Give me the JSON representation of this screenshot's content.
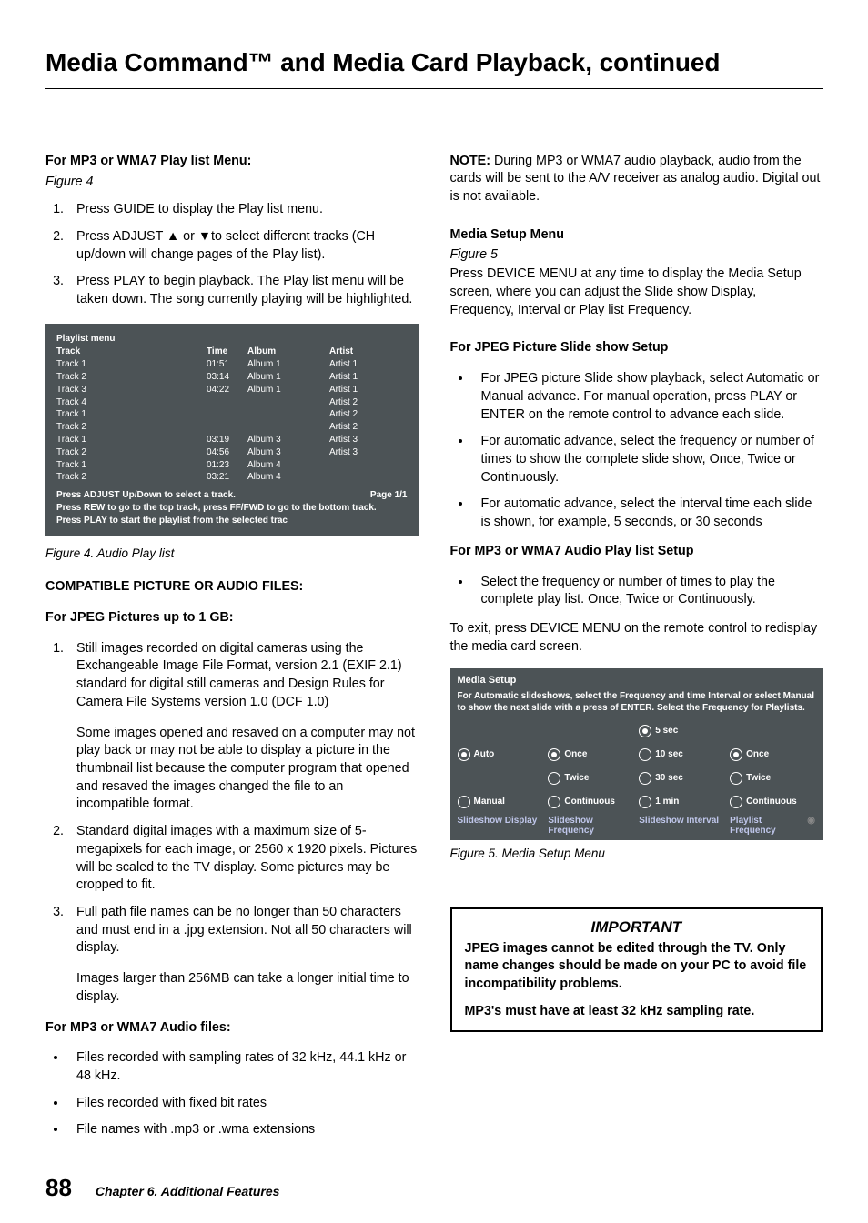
{
  "page_title": "Media Command™ and Media Card Playback, continued",
  "left": {
    "h1": "For MP3 or WMA7 Play list Menu:",
    "fig4_label": "Figure 4",
    "ol1": [
      "Press GUIDE to display the Play list menu.",
      "Press ADJUST ▲ or ▼to select different tracks (CH up/down will change pages of the Play list).",
      "Press PLAY to begin playback.  The Play list menu will be taken down. The song currently playing will be highlighted."
    ],
    "playlist": {
      "title": "Playlist menu",
      "headers": [
        "Track",
        "Time",
        "Album",
        "Artist"
      ],
      "rows": [
        [
          "Track 1",
          "01:51",
          "Album 1",
          "Artist 1"
        ],
        [
          "Track 2",
          "03:14",
          "Album 1",
          "Artist 1"
        ],
        [
          "Track 3",
          "04:22",
          "Album 1",
          "Artist 1"
        ],
        [
          "Track 4",
          "",
          "",
          "Artist 2"
        ],
        [
          "Track 1",
          "",
          "",
          "Artist 2"
        ],
        [
          "Track 2",
          "",
          "",
          "Artist 2"
        ],
        [
          "Track 1",
          "03:19",
          "Album 3",
          "Artist 3"
        ],
        [
          "Track 2",
          "04:56",
          "Album 3",
          "Artist 3"
        ],
        [
          "Track 1",
          "01:23",
          "Album 4",
          ""
        ],
        [
          "Track 2",
          "03:21",
          "Album 4",
          ""
        ]
      ],
      "foot1a": "Press ADJUST Up/Down to select a track.",
      "foot1b": "Page 1/1",
      "foot2": "Press REW to go to the top track, press FF/FWD to go to the bottom track.",
      "foot3": "Press PLAY to start the playlist from the selected trac"
    },
    "caption4": "Figure 4.  Audio Play list",
    "h2": "COMPATIBLE PICTURE OR AUDIO FILES:",
    "h3": "For JPEG Pictures up to 1 GB:",
    "ol2": [
      "Still images recorded on digital cameras using the Exchangeable Image File Format, version 2.1 (EXIF 2.1) standard for digital still cameras and Design Rules for Camera File Systems version 1.0 (DCF 1.0)",
      "Standard digital images with a maximum size of 5-megapixels for each image, or 2560 x 1920 pixels.  Pictures will be scaled to the TV display.  Some pictures may be cropped to fit.",
      "Full path file names can be no longer than 50 characters and must end in a .jpg extension.  Not all 50 characters will display."
    ],
    "ol2_sub1": "Some images opened and resaved on a computer may not play back or may not be able to display a picture in the thumbnail list because the computer program that opened and resaved the images changed the file to an incompatible format.",
    "ol2_sub3": "Images larger than 256MB can take a longer initial time to display.",
    "h4": "For MP3 or WMA7 Audio files:",
    "ul1": [
      "Files recorded with sampling rates of 32 kHz, 44.1 kHz or 48 kHz.",
      "Files recorded with fixed bit rates",
      "File names with .mp3 or .wma extensions"
    ]
  },
  "right": {
    "note_label": "NOTE:",
    "note_text": "  During MP3 or WMA7 audio playback, audio from the cards will be sent to the A/V receiver as analog audio.  Digital out is not available.",
    "h1": "Media Setup Menu",
    "fig5_label": "Figure 5",
    "p1": "Press DEVICE MENU at any time to display the Media Setup screen, where you can adjust the Slide show Display, Frequency, Interval or Play list Frequency.",
    "h2": "For JPEG Picture Slide show Setup",
    "ul1": [
      "For JPEG picture Slide show playback, select Automatic or Manual advance.  For manual operation, press PLAY or ENTER on the remote control to advance each slide.",
      "For automatic advance, select the frequency or number of times to show the complete slide show, Once, Twice or Continuously.",
      "For automatic advance, select the interval time each slide is shown, for example, 5 seconds, or 30 seconds"
    ],
    "h3": "For MP3 or WMA7 Audio Play list Setup",
    "ul2": [
      "Select the frequency or number of times to play the complete play list.  Once, Twice or Continuously."
    ],
    "p2": "To exit, press DEVICE MENU on the remote control to redisplay the media card screen.",
    "media_setup": {
      "title": "Media Setup",
      "desc": "For Automatic slideshows, select the Frequency and time Interval or select Manual to show the next slide with a press of ENTER. Select the Frequency for Playlists.",
      "col1": {
        "opts": [
          "Auto",
          "Manual"
        ],
        "sel": 0,
        "label": "Slideshow Display"
      },
      "col2": {
        "opts": [
          "Once",
          "Twice",
          "Continuous"
        ],
        "sel": 0,
        "label": "Slideshow Frequency"
      },
      "col3": {
        "opts": [
          "5 sec",
          "10 sec",
          "30 sec",
          "1 min"
        ],
        "sel": 0,
        "label": "Slideshow Interval"
      },
      "col4": {
        "opts": [
          "Once",
          "Twice",
          "Continuous"
        ],
        "sel": 0,
        "label": "Playlist Frequency"
      }
    },
    "caption5": "Figure 5.  Media Setup Menu",
    "important": {
      "title": "IMPORTANT",
      "p1": "JPEG images cannot be edited through the TV. Only name changes should be made on your PC to avoid file incompatibility problems.",
      "p2": "MP3's must have at least 32 kHz sampling rate."
    }
  },
  "footer": {
    "page": "88",
    "chapter": "Chapter 6. Additional Features"
  }
}
